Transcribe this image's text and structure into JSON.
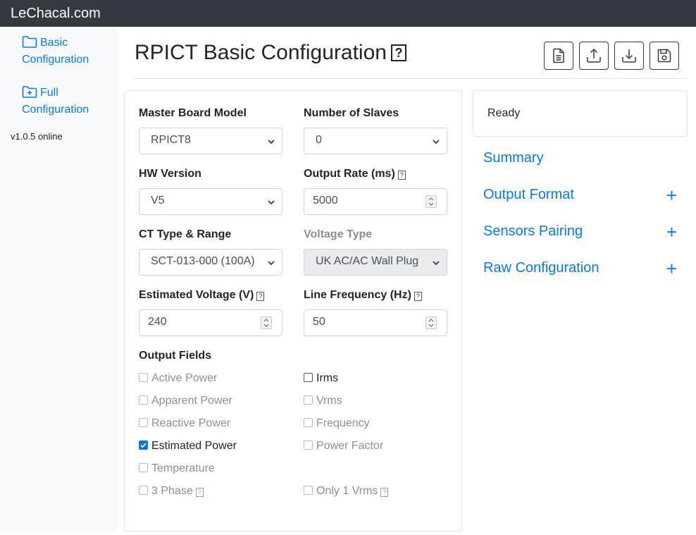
{
  "app": {
    "brand": "LeChacal.com",
    "version": "v1.0.5 online"
  },
  "sidebar": {
    "items": [
      {
        "label": "Basic Configuration"
      },
      {
        "label": "Full Configuration"
      }
    ]
  },
  "page": {
    "title": "RPICT Basic Configuration",
    "help": "?"
  },
  "form": {
    "master_board_label": "Master Board Model",
    "master_board_value": "RPICT8",
    "slaves_label": "Number of Slaves",
    "slaves_value": "0",
    "hw_version_label": "HW Version",
    "hw_version_value": "V5",
    "output_rate_label": "Output Rate (ms)",
    "output_rate_value": "5000",
    "ct_type_label": "CT Type & Range",
    "ct_type_value": "SCT-013-000 (100A)",
    "voltage_type_label": "Voltage Type",
    "voltage_type_value": "UK AC/AC Wall Plug",
    "est_voltage_label": "Estimated Voltage (V)",
    "est_voltage_value": "240",
    "line_freq_label": "Line Frequency (Hz)",
    "line_freq_value": "50",
    "output_fields_label": "Output Fields",
    "fields": {
      "active_power": "Active Power",
      "apparent_power": "Apparent Power",
      "reactive_power": "Reactive Power",
      "estimated_power": "Estimated Power",
      "temperature": "Temperature",
      "three_phase": "3 Phase",
      "irms": "Irms",
      "vrms": "Vrms",
      "frequency": "Frequency",
      "power_factor": "Power Factor",
      "only_1_vrms": "Only 1 Vrms"
    }
  },
  "status": {
    "text": "Ready"
  },
  "accordion": {
    "summary": "Summary",
    "output_format": "Output Format",
    "sensors_pairing": "Sensors Pairing",
    "raw_configuration": "Raw Configuration",
    "plus": "+"
  },
  "colors": {
    "topbar": "#343a40",
    "link": "#007bff",
    "checkbox_checked": "#0075ff"
  }
}
